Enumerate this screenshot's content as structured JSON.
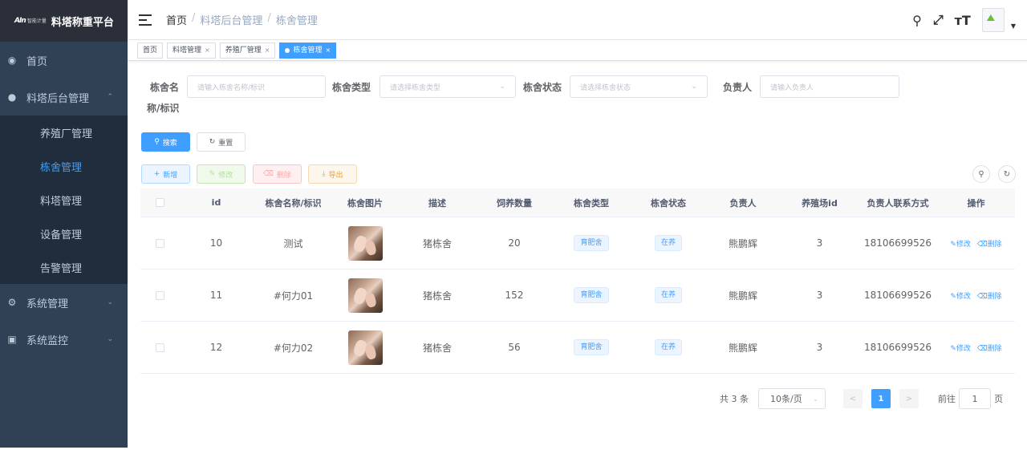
{
  "logo": {
    "mark": "AIn",
    "mark_sub": "智能计量",
    "title": "料塔称重平台"
  },
  "sidebar": {
    "items": [
      {
        "label": "首页",
        "icon": "dashboard-icon"
      },
      {
        "label": "料塔后台管理",
        "icon": "user-icon",
        "expanded": true,
        "children": [
          "养殖厂管理",
          "栋舍管理",
          "料塔管理",
          "设备管理",
          "告警管理"
        ]
      },
      {
        "label": "系统管理",
        "icon": "gear-icon"
      },
      {
        "label": "系统监控",
        "icon": "monitor-icon"
      }
    ],
    "active_child": "栋舍管理"
  },
  "navbar": {
    "breadcrumb": [
      "首页",
      "料塔后台管理",
      "栋舍管理"
    ],
    "breadcrumb_sep": "/"
  },
  "tags": [
    {
      "label": "首页",
      "closable": false
    },
    {
      "label": "料塔管理",
      "closable": true
    },
    {
      "label": "养殖厂管理",
      "closable": true
    },
    {
      "label": "栋舍管理",
      "closable": true,
      "active": true
    }
  ],
  "tag_close": "×",
  "search_form": {
    "name_label_1": "栋舍名",
    "name_label_2": "称/标识",
    "name_placeholder": "请输入栋舍名称/标识",
    "type_label": "栋舍类型",
    "type_placeholder": "请选择栋舍类型",
    "status_label": "栋舍状态",
    "status_placeholder": "请选择栋舍状态",
    "owner_label": "负责人",
    "owner_placeholder": "请输入负责人",
    "search_btn": "搜索",
    "reset_btn": "重置"
  },
  "toolbar": {
    "add": "新增",
    "edit": "修改",
    "delete": "删除",
    "export": "导出"
  },
  "table": {
    "columns": [
      "id",
      "栋舍名称/标识",
      "栋舍图片",
      "描述",
      "饲养数量",
      "栋舍类型",
      "栋舍状态",
      "负责人",
      "养殖场id",
      "负责人联系方式",
      "操作"
    ],
    "rows": [
      {
        "id": "10",
        "name": "测试",
        "desc": "猪栋舍",
        "count": "20",
        "type": "育肥舍",
        "status": "在养",
        "owner": "熊鹏辉",
        "farm_id": "3",
        "phone": "18106699526"
      },
      {
        "id": "11",
        "name": "#何力01",
        "desc": "猪栋舍",
        "count": "152",
        "type": "育肥舍",
        "status": "在养",
        "owner": "熊鹏辉",
        "farm_id": "3",
        "phone": "18106699526"
      },
      {
        "id": "12",
        "name": "#何力02",
        "desc": "猪栋舍",
        "count": "56",
        "type": "育肥舍",
        "status": "在养",
        "owner": "熊鹏辉",
        "farm_id": "3",
        "phone": "18106699526"
      }
    ],
    "op_edit": "修改",
    "op_delete": "删除"
  },
  "pagination": {
    "total": "共 3 条",
    "page_size": "10条/页",
    "current": "1",
    "goto_prefix": "前往",
    "goto_value": "1",
    "goto_suffix": "页"
  },
  "colors": {
    "primary": "#409eff",
    "sidebar_bg": "#304156",
    "submenu_bg": "#1f2d3d"
  }
}
